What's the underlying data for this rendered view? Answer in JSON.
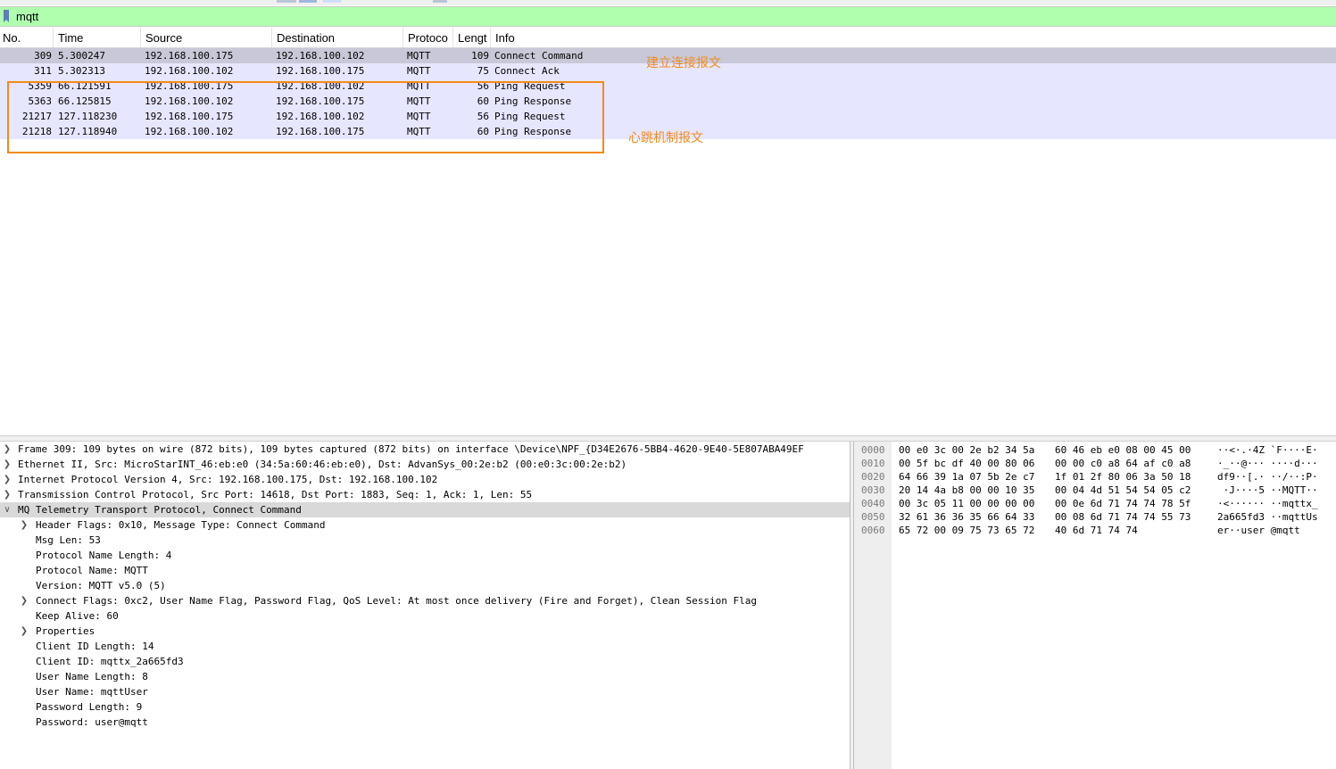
{
  "filter": {
    "value": "mqtt"
  },
  "columns": [
    "No.",
    "Time",
    "Source",
    "Destination",
    "Protoco",
    "Lengt",
    "Info"
  ],
  "packets": [
    {
      "no": "309",
      "time": "5.300247",
      "src": "192.168.100.175",
      "dst": "192.168.100.102",
      "proto": "MQTT",
      "len": "109",
      "info": "Connect Command"
    },
    {
      "no": "311",
      "time": "5.302313",
      "src": "192.168.100.102",
      "dst": "192.168.100.175",
      "proto": "MQTT",
      "len": "75",
      "info": "Connect Ack"
    },
    {
      "no": "5359",
      "time": "66.121591",
      "src": "192.168.100.175",
      "dst": "192.168.100.102",
      "proto": "MQTT",
      "len": "56",
      "info": "Ping Request"
    },
    {
      "no": "5363",
      "time": "66.125815",
      "src": "192.168.100.102",
      "dst": "192.168.100.175",
      "proto": "MQTT",
      "len": "60",
      "info": "Ping Response"
    },
    {
      "no": "21217",
      "time": "127.118230",
      "src": "192.168.100.175",
      "dst": "192.168.100.102",
      "proto": "MQTT",
      "len": "56",
      "info": "Ping Request"
    },
    {
      "no": "21218",
      "time": "127.118940",
      "src": "192.168.100.102",
      "dst": "192.168.100.175",
      "proto": "MQTT",
      "len": "60",
      "info": "Ping Response"
    }
  ],
  "annotations": {
    "connect": "建立连接报文",
    "heartbeat": "心跳机制报文"
  },
  "details": [
    {
      "text": "Frame 309: 109 bytes on wire (872 bits), 109 bytes captured (872 bits) on interface \\Device\\NPF_{D34E2676-5BB4-4620-9E40-5E807ABA49EF"
    },
    {
      "text": "Ethernet II, Src: MicroStarINT_46:eb:e0 (34:5a:60:46:eb:e0), Dst: AdvanSys_00:2e:b2 (00:e0:3c:00:2e:b2)"
    },
    {
      "text": "Internet Protocol Version 4, Src: 192.168.100.175, Dst: 192.168.100.102"
    },
    {
      "text": "Transmission Control Protocol, Src Port: 14618, Dst Port: 1883, Seq: 1, Ack: 1, Len: 55"
    },
    {
      "text": "MQ Telemetry Transport Protocol, Connect Command"
    },
    {
      "text": "Header Flags: 0x10, Message Type: Connect Command"
    },
    {
      "text": "Msg Len: 53"
    },
    {
      "text": "Protocol Name Length: 4"
    },
    {
      "text": "Protocol Name: MQTT"
    },
    {
      "text": "Version: MQTT v5.0 (5)"
    },
    {
      "text": "Connect Flags: 0xc2, User Name Flag, Password Flag, QoS Level: At most once delivery (Fire and Forget), Clean Session Flag"
    },
    {
      "text": "Keep Alive: 60"
    },
    {
      "text": "Properties"
    },
    {
      "text": "Client ID Length: 14"
    },
    {
      "text": "Client ID: mqttx_2a665fd3"
    },
    {
      "text": "User Name Length: 8"
    },
    {
      "text": "User Name: mqttUser"
    },
    {
      "text": "Password Length: 9"
    },
    {
      "text": "Password: user@mqtt"
    }
  ],
  "hex": [
    {
      "off": "0000",
      "h1": "00 e0 3c 00 2e b2 34 5a",
      "h2": "60 46 eb e0 08 00 45 00",
      "asc": "··<·.·4Z `F····E·"
    },
    {
      "off": "0010",
      "h1": "00 5f bc df 40 00 80 06",
      "h2": "00 00 c0 a8 64 af c0 a8",
      "asc": "·_··@··· ····d···"
    },
    {
      "off": "0020",
      "h1": "64 66 39 1a 07 5b 2e c7",
      "h2": "1f 01 2f 80 06 3a 50 18",
      "asc": "df9··[.· ··/··:P·"
    },
    {
      "off": "0030",
      "h1": "20 14 4a b8 00 00 10 35",
      "h2": "00 04 4d 51 54 54 05 c2",
      "asc": " ·J····5 ··MQTT··"
    },
    {
      "off": "0040",
      "h1": "00 3c 05 11 00 00 00 00",
      "h2": "00 0e 6d 71 74 74 78 5f",
      "asc": "·<······ ··mqttx_"
    },
    {
      "off": "0050",
      "h1": "32 61 36 36 35 66 64 33",
      "h2": "00 08 6d 71 74 74 55 73",
      "asc": "2a665fd3 ··mqttUs"
    },
    {
      "off": "0060",
      "h1": "65 72 00 09 75 73 65 72",
      "h2": "40 6d 71 74 74",
      "asc": "er··user @mqtt"
    }
  ],
  "icons": {
    "expanded": "chevron-down-icon",
    "collapsed": "chevron-right-icon",
    "bookmark": "bookmark-icon"
  },
  "colors": {
    "filter_ok": "#afffaf",
    "row_mqtt": "#e7e6ff",
    "row_selected": "#c8c8d8",
    "annotation": "#f28b1d"
  }
}
